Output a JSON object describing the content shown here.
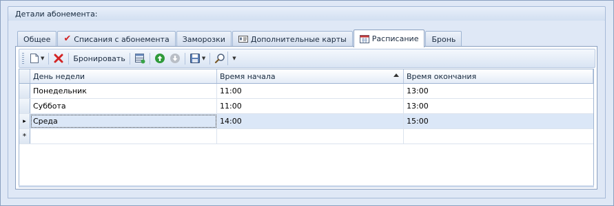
{
  "group": {
    "title": "Детали абонемента:"
  },
  "tabs": [
    {
      "label": "Общее",
      "icon": "none"
    },
    {
      "label": "Списания с абонемента",
      "icon": "checkmark-icon"
    },
    {
      "label": "Заморозки",
      "icon": "none"
    },
    {
      "label": "Дополнительные карты",
      "icon": "card-icon"
    },
    {
      "label": "Расписание",
      "icon": "calendar-icon",
      "active": true
    },
    {
      "label": "Бронь",
      "icon": "none"
    }
  ],
  "toolbar": {
    "book_label": "Бронировать"
  },
  "grid": {
    "columns": [
      "День недели",
      "Время начала",
      "Время окончания"
    ],
    "sorted_column": "Время начала",
    "rows": [
      {
        "day": "Понедельник",
        "start": "11:00",
        "end": "13:00"
      },
      {
        "day": "Суббота",
        "start": "11:00",
        "end": "13:00"
      },
      {
        "day": "Среда",
        "start": "14:00",
        "end": "15:00",
        "selected": true
      }
    ],
    "new_row_marker": "*",
    "current_row_marker": "▸"
  },
  "colors": {
    "accent": "#dbe7f7",
    "delete_red": "#d22424",
    "nav_green": "#2f9a3a"
  }
}
